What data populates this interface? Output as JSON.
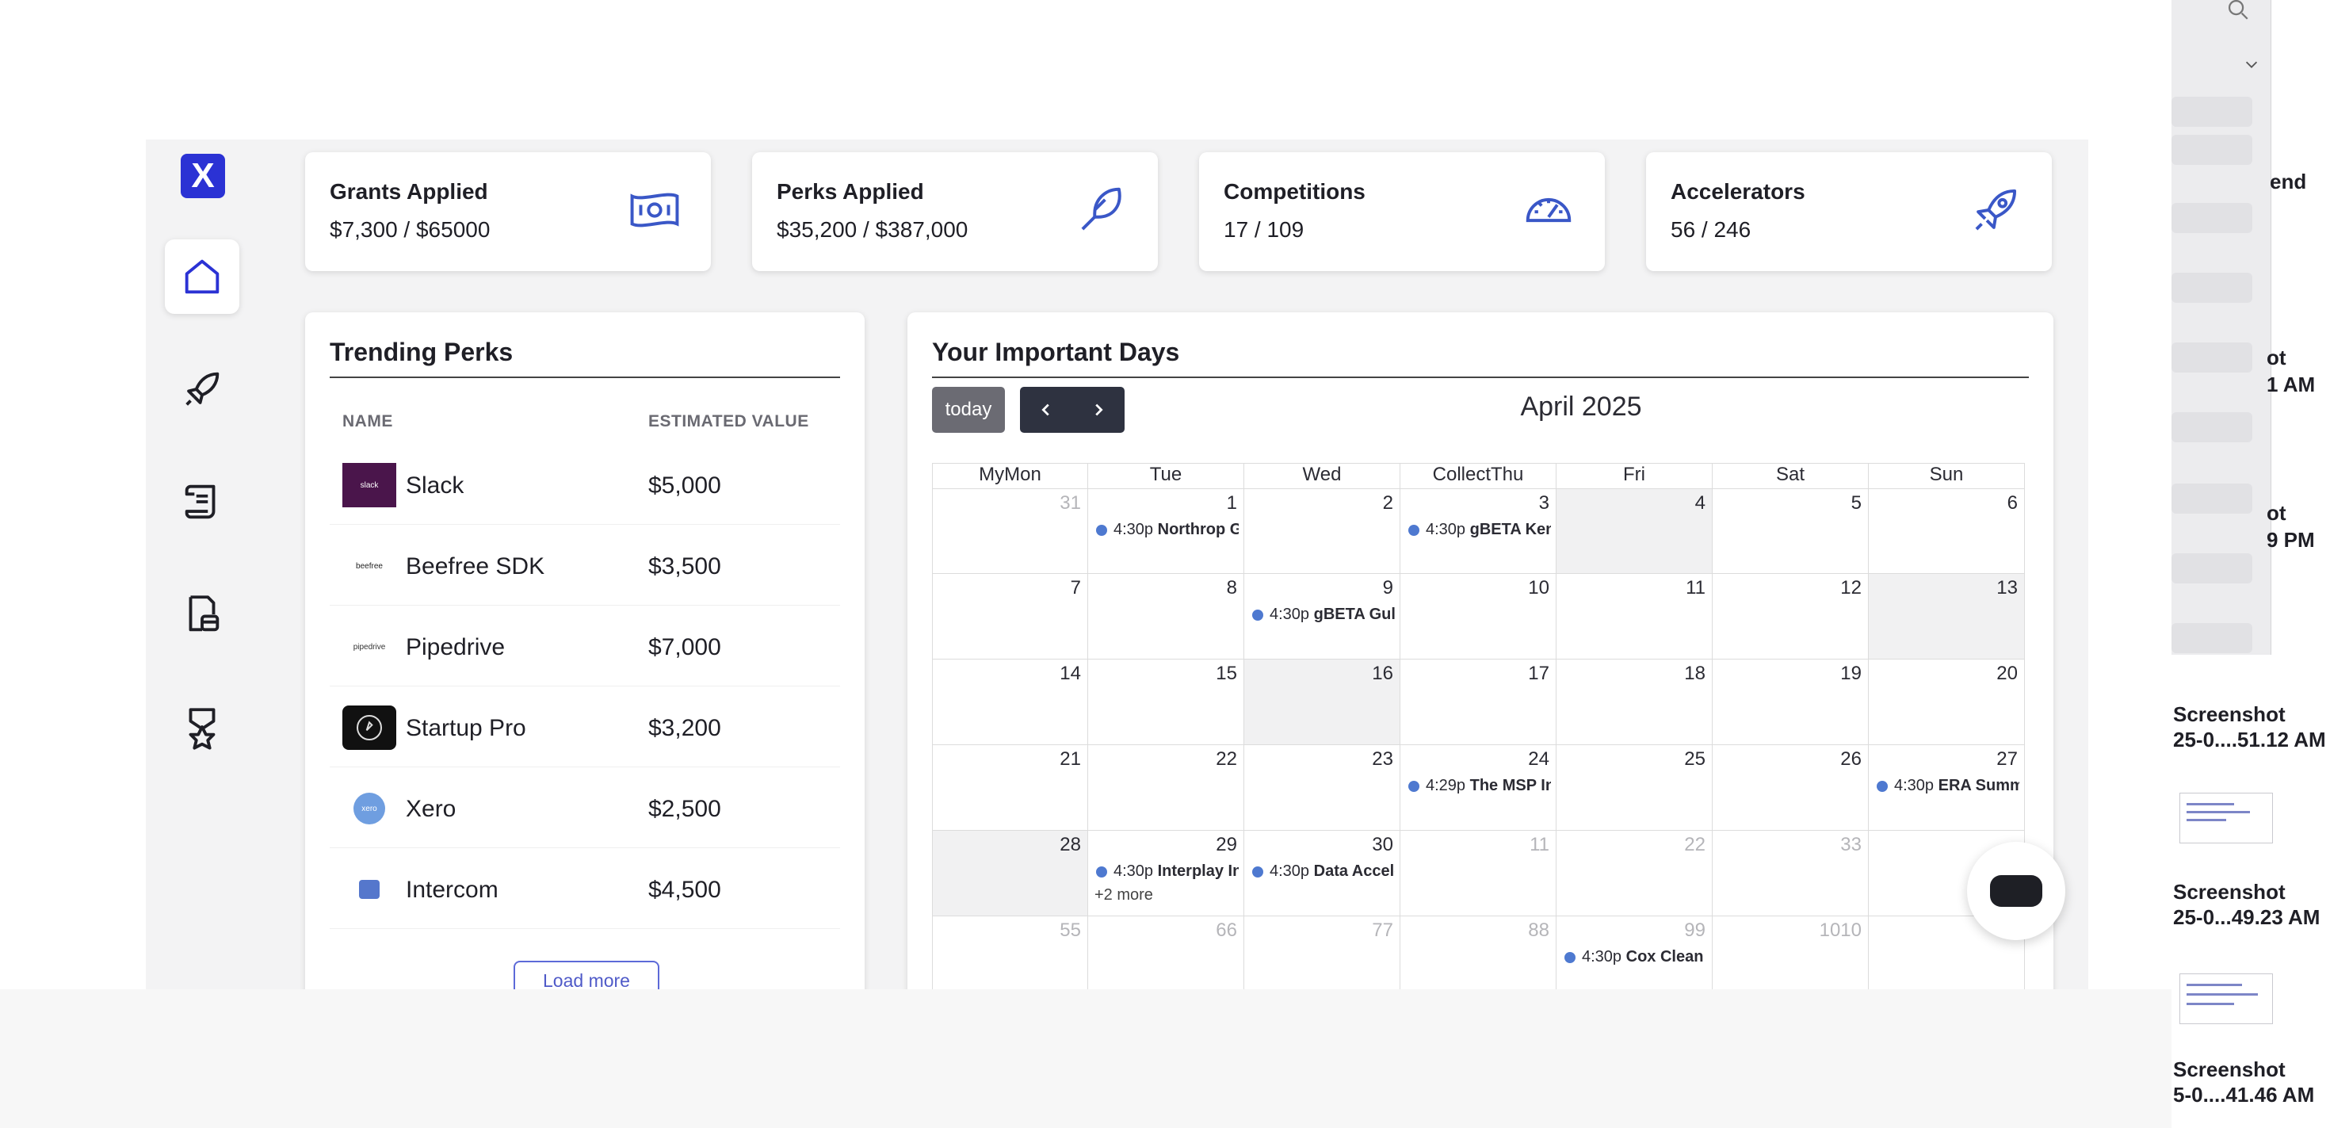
{
  "stats": [
    {
      "title": "Grants Applied",
      "value": "$7,300 / $65000",
      "icon": "money-icon"
    },
    {
      "title": "Perks Applied",
      "value": "$35,200 / $387,000",
      "icon": "feather-icon"
    },
    {
      "title": "Competitions",
      "value": "17 / 109",
      "icon": "speedometer-icon"
    },
    {
      "title": "Accelerators",
      "value": "56 / 246",
      "icon": "rocket-icon"
    }
  ],
  "trending": {
    "title": "Trending Perks",
    "col_name": "NAME",
    "col_value": "ESTIMATED VALUE",
    "load_more": "Load more",
    "perks": [
      {
        "name": "Slack",
        "value": "$5,000",
        "logo_text": "slack"
      },
      {
        "name": "Beefree SDK",
        "value": "$3,500",
        "logo_text": "beefree"
      },
      {
        "name": "Pipedrive",
        "value": "$7,000",
        "logo_text": "pipedrive"
      },
      {
        "name": "Startup Pro",
        "value": "$3,200",
        "logo_text": ""
      },
      {
        "name": "Xero",
        "value": "$2,500",
        "logo_text": "xero"
      },
      {
        "name": "Intercom",
        "value": "$4,500",
        "logo_text": ""
      }
    ]
  },
  "calendar": {
    "title": "Your Important Days",
    "today_label": "today",
    "month": "April 2025",
    "weekdays": [
      "MyMon",
      "Tue",
      "Wed",
      "CollectThu",
      "Fri",
      "Sat",
      "Sun"
    ],
    "weeks": [
      [
        {
          "d": "31",
          "m": true
        },
        {
          "d": "1",
          "e": "4:30p",
          "t": "Northrop Grumman"
        },
        {
          "d": "2"
        },
        {
          "d": "3",
          "e": "4:30p",
          "t": "gBETA Kent"
        },
        {
          "d": "4",
          "s": true
        },
        {
          "d": "5"
        },
        {
          "d": "6"
        }
      ],
      [
        {
          "d": "7"
        },
        {
          "d": "8"
        },
        {
          "d": "9",
          "e": "4:30p",
          "t": "gBETA Gulf"
        },
        {
          "d": "10"
        },
        {
          "d": "11"
        },
        {
          "d": "12"
        },
        {
          "d": "13",
          "s": true
        }
      ],
      [
        {
          "d": "14"
        },
        {
          "d": "15"
        },
        {
          "d": "16",
          "s": true
        },
        {
          "d": "17"
        },
        {
          "d": "18"
        },
        {
          "d": "19"
        },
        {
          "d": "20"
        }
      ],
      [
        {
          "d": "21"
        },
        {
          "d": "22"
        },
        {
          "d": "23"
        },
        {
          "d": "24",
          "e": "4:29p",
          "t": "The MSP Innovation"
        },
        {
          "d": "25"
        },
        {
          "d": "26"
        },
        {
          "d": "27",
          "e": "4:30p",
          "t": "ERA Summer"
        }
      ],
      [
        {
          "d": "28",
          "s": true
        },
        {
          "d": "29",
          "e": "4:30p",
          "t": "Interplay Innovation",
          "more": "+2 more"
        },
        {
          "d": "30",
          "e": "4:30p",
          "t": "Data Accelerator"
        },
        {
          "d": "11",
          "m": true
        },
        {
          "d": "22",
          "m": true
        },
        {
          "d": "33",
          "m": true
        },
        {
          "d": "",
          "m": true
        }
      ],
      [
        {
          "d": "55",
          "m": true
        },
        {
          "d": "66",
          "m": true
        },
        {
          "d": "77",
          "m": true
        },
        {
          "d": "88",
          "m": true
        },
        {
          "d": "99",
          "m": true,
          "e": "4:30p",
          "t": "Cox Clean"
        },
        {
          "d": "1010",
          "m": true
        },
        {
          "d": "",
          "m": true
        }
      ]
    ]
  },
  "right_strip": {
    "labels": [
      "end",
      "ot",
      "1 AM",
      "ot",
      "9 PM"
    ],
    "items": [
      {
        "title": "Screenshot",
        "sub": "25-0....51.12 AM"
      },
      {
        "title": "Screenshot",
        "sub": "25-0...49.23 AM"
      },
      {
        "title": "Screenshot",
        "sub": "5-0....41.46 AM"
      }
    ]
  },
  "colors": {
    "accent": "#2b32d4",
    "event_dot": "#4e79d0",
    "nav_button": "#2e3240"
  }
}
